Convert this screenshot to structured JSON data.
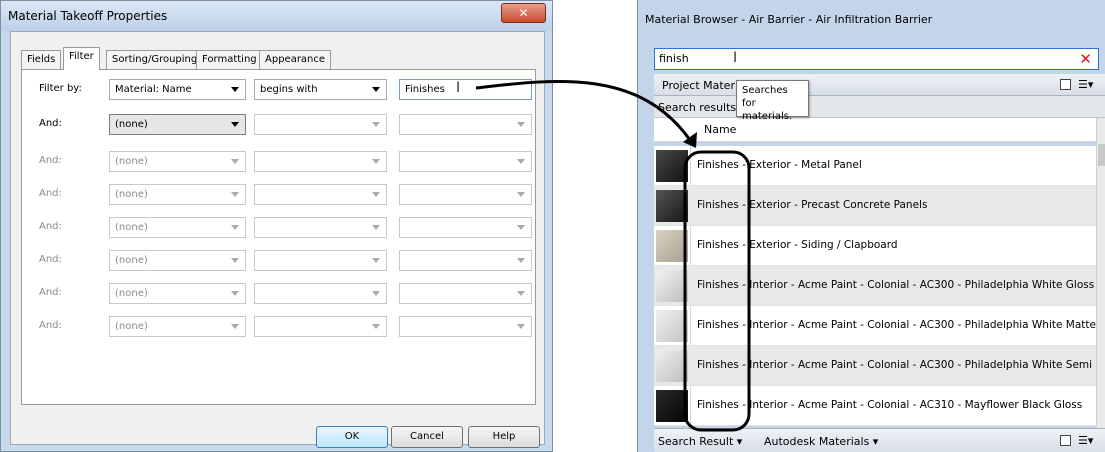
{
  "dialog": {
    "title": "Material Takeoff Properties",
    "close_glyph": "✕",
    "tabs": [
      "Fields",
      "Filter",
      "Sorting/Grouping",
      "Formatting",
      "Appearance"
    ],
    "active_tab": "Filter",
    "rows": [
      {
        "label": "Filter by:",
        "field": "Material: Name",
        "op": "begins with",
        "value": "Finishes"
      },
      {
        "label": "And:",
        "field": "(none)",
        "op": "",
        "value": ""
      },
      {
        "label": "And:",
        "field": "(none)",
        "op": "",
        "value": ""
      },
      {
        "label": "And:",
        "field": "(none)",
        "op": "",
        "value": ""
      },
      {
        "label": "And:",
        "field": "(none)",
        "op": "",
        "value": ""
      },
      {
        "label": "And:",
        "field": "(none)",
        "op": "",
        "value": ""
      },
      {
        "label": "And:",
        "field": "(none)",
        "op": "",
        "value": ""
      },
      {
        "label": "And:",
        "field": "(none)",
        "op": "",
        "value": ""
      }
    ],
    "buttons": {
      "ok": "OK",
      "cancel": "Cancel",
      "help": "Help"
    }
  },
  "browser": {
    "title": "Material Browser - Air Barrier - Air Infiltration Barrier",
    "search_value": "finish",
    "clear_glyph": "✕",
    "crumb": "Project Materials: All",
    "tooltip": "Searches for materials.",
    "results_header": "Search results for",
    "column_name": "Name",
    "items": [
      "Finishes - Exterior - Metal Panel",
      "Finishes - Exterior - Precast Concrete Panels",
      "Finishes - Exterior - Siding / Clapboard",
      "Finishes - Interior - Acme Paint - Colonial - AC300 - Philadelphia White Gloss",
      "Finishes - Interior - Acme Paint - Colonial - AC300 - Philadelphia White Matte",
      "Finishes - Interior - Acme Paint - Colonial - AC300 - Philadelphia White Semi Gl",
      "Finishes - Interior - Acme Paint - Colonial - AC310 - Mayflower Black Gloss"
    ],
    "bottom_tabs": [
      "Search Result",
      "Autodesk Materials"
    ]
  }
}
